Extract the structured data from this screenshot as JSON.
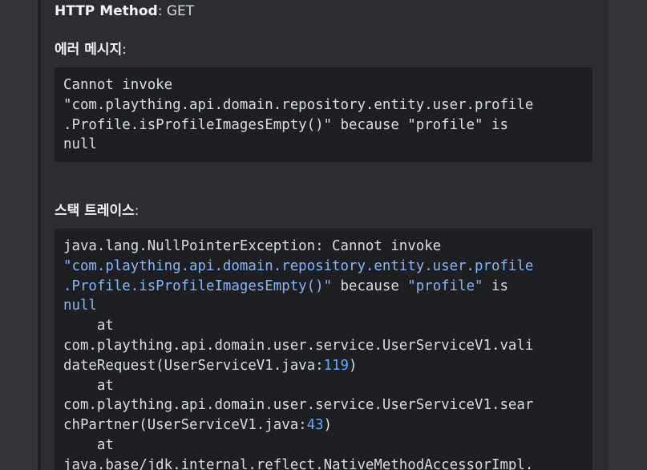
{
  "http_method": {
    "label": "HTTP Method",
    "separator": ":",
    "value": " GET"
  },
  "error_message": {
    "label": "에러 메시지",
    "colon": ":",
    "lines": [
      "Cannot invoke",
      "\"com.plaything.api.domain.repository.entity.user.profile",
      ".Profile.isProfileImagesEmpty()\" because \"profile\" is",
      "null"
    ]
  },
  "stack_trace": {
    "label": "스택 트레이스",
    "colon": ":",
    "line1": "java.lang.NullPointerException: Cannot invoke",
    "line2": "\"com.plaything.api.domain.repository.entity.user.profile",
    "line3_a": ".Profile.isProfileImagesEmpty()\"",
    "line3_b": " because ",
    "line3_c": "\"profile\"",
    "line3_d": " is",
    "line4": "null",
    "at_1": "    at",
    "frame1_line1": "com.plaything.api.domain.user.service.UserServiceV1.vali",
    "frame1_line2_a": "dateRequest(UserServiceV1.java:",
    "frame1_line2_num": "119",
    "frame1_line2_b": ")",
    "at_2": "    at",
    "frame2_line1": "com.plaything.api.domain.user.service.UserServiceV1.sear",
    "frame2_line2_a": "chPartner(UserServiceV1.java:",
    "frame2_line2_num": "43",
    "frame2_line2_b": ")",
    "at_3": "    at",
    "frame3_line1": "java.base/jdk.internal.reflect.NativeMethodAccessorImpl."
  }
}
